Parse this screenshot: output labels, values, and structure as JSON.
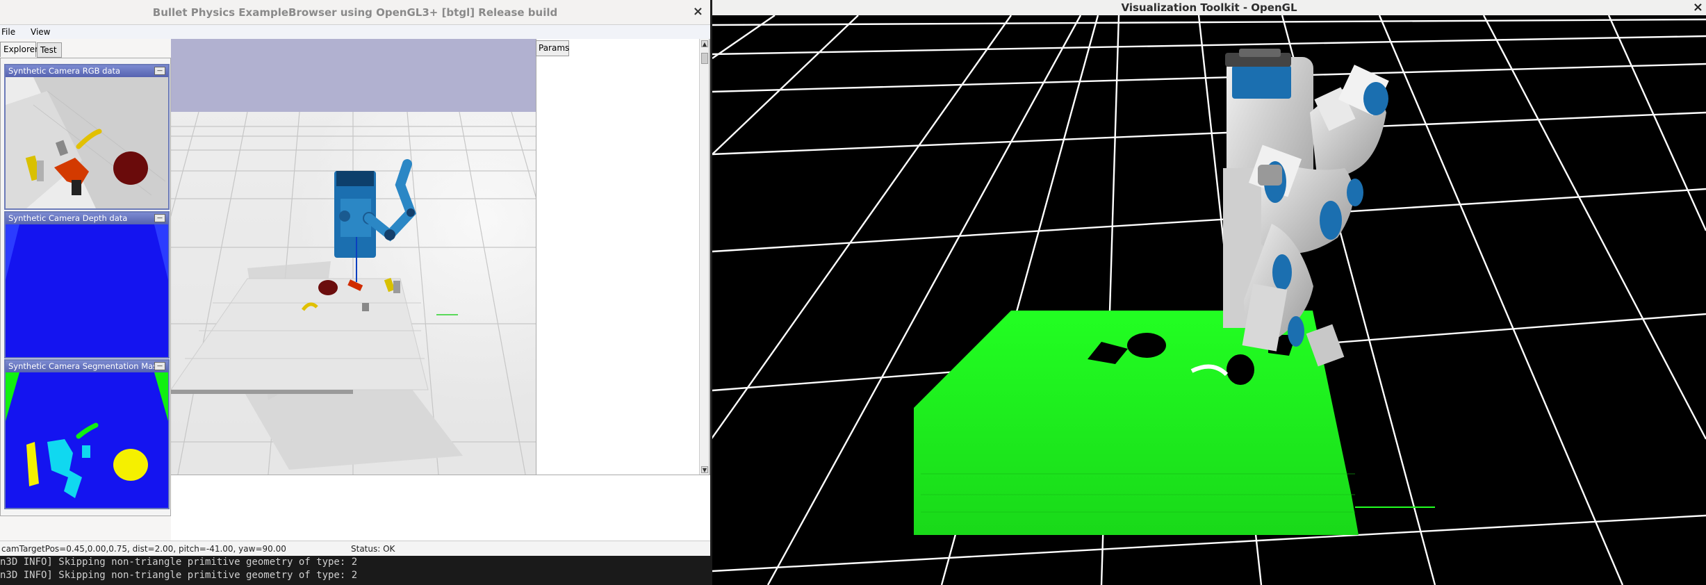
{
  "terminal": {
    "lines": [
      "n3D INFO] Skipping non-triangle primitive geometry of type: 2",
      "n3D INFO] Skipping non-triangle primitive geometry of type: 2"
    ]
  },
  "bullet_window": {
    "title": "Bullet Physics ExampleBrowser using OpenGL3+ [btgl] Release build",
    "close_glyph": "×",
    "menu": {
      "file": "File",
      "view": "View"
    },
    "tabs": {
      "explorer": "Explorer",
      "test": "Test",
      "params": "Params"
    },
    "cameras": {
      "rgb": "Synthetic Camera RGB data",
      "depth": "Synthetic Camera Depth data",
      "seg": "Synthetic Camera Segmentation Mask"
    },
    "minimize_glyph": "—",
    "status": {
      "cam": "camTargetPos=0.45,0.00,0.75, dist=2.00, pitch=-41.00, yaw=90.00",
      "state": "Status: OK"
    },
    "scroll_up_glyph": "▲",
    "scroll_down_glyph": "▼"
  },
  "vtk_window": {
    "title": "Visualization Toolkit - OpenGL",
    "close_glyph": "×"
  },
  "colors": {
    "depth_blue": "#1414f0",
    "seg_yellow": "#f5f000",
    "seg_cyan": "#10d8f0",
    "seg_green": "#10f010",
    "robot_blue": "#1b6fb0",
    "vtk_green": "#22ff22"
  }
}
